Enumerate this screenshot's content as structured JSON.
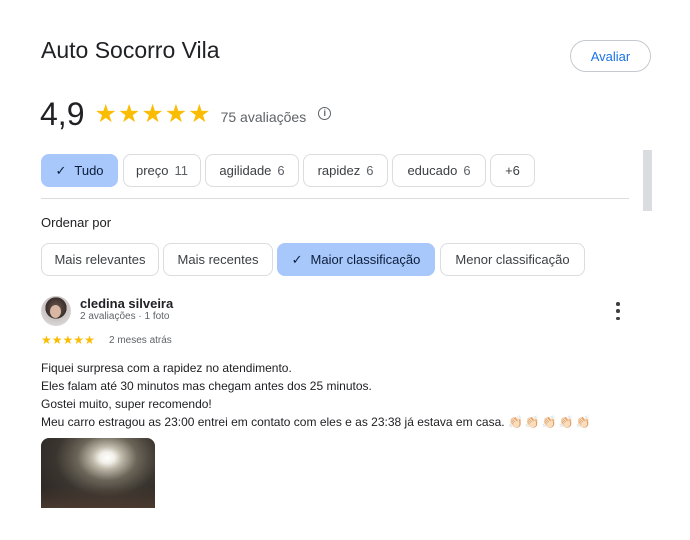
{
  "place": {
    "title": "Auto Socorro Vila",
    "rate_button": "Avaliar"
  },
  "rating": {
    "value": "4,9",
    "stars": 5,
    "count_text": "75 avaliações",
    "info_icon": "info-icon"
  },
  "topic_chips": [
    {
      "label": "Tudo",
      "count": "",
      "active": true
    },
    {
      "label": "preço",
      "count": "11",
      "active": false
    },
    {
      "label": "agilidade",
      "count": "6",
      "active": false
    },
    {
      "label": "rapidez",
      "count": "6",
      "active": false
    },
    {
      "label": "educado",
      "count": "6",
      "active": false
    },
    {
      "label": "+6",
      "count": "",
      "active": false
    }
  ],
  "sort": {
    "label": "Ordenar por",
    "options": [
      {
        "label": "Mais relevantes",
        "active": false
      },
      {
        "label": "Mais recentes",
        "active": false
      },
      {
        "label": "Maior classificação",
        "active": true
      },
      {
        "label": "Menor classificação",
        "active": false
      }
    ]
  },
  "review": {
    "author": "cledina silveira",
    "meta": "2 avaliações · 1 foto",
    "stars": 5,
    "date": "2 meses atrás",
    "lines": [
      "Fiquei surpresa com a rapidez no atendimento.",
      "Eles falam até 30 minutos mas chegam antes dos 25 minutos.",
      "Gostei muito, super recomendo!",
      "Meu carro estragou as 23:00 entrei em contato com eles e as 23:38 já estava em casa."
    ],
    "emoji": "👏🏻👏🏻👏🏻👏🏻👏🏻"
  },
  "colors": {
    "accent": "#1a73e8",
    "star": "#fbbc04",
    "chip_active_bg": "#a8c7fa",
    "border": "#dadce0"
  }
}
